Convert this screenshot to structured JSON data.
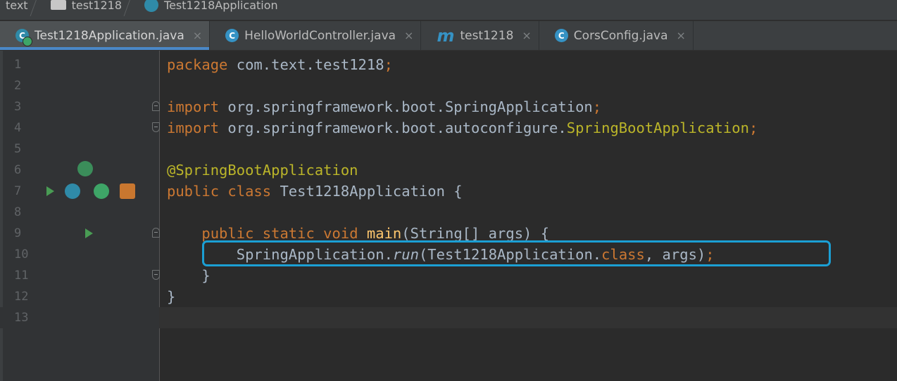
{
  "breadcrumb": [
    "text",
    "test1218",
    "Test1218Application"
  ],
  "tabs": [
    {
      "label": "Test1218Application.java",
      "icon": "spring-class-icon",
      "active": true
    },
    {
      "label": "HelloWorldController.java",
      "icon": "class-icon",
      "active": false
    },
    {
      "label": "test1218",
      "icon": "maven-icon",
      "active": false
    },
    {
      "label": "CorsConfig.java",
      "icon": "class-icon",
      "active": false
    }
  ],
  "tab_close": "×",
  "class_icon_letter": "C",
  "maven_icon_letter": "m",
  "line_numbers": [
    "1",
    "2",
    "3",
    "4",
    "5",
    "6",
    "7",
    "8",
    "9",
    "10",
    "11",
    "12",
    "13"
  ],
  "code": {
    "l1": {
      "kw": "package",
      "rest": " com.text.test1218",
      "semi": ";"
    },
    "l3": {
      "kw": "import",
      "rest": " org.springframework.boot.SpringApplication",
      "semi": ";"
    },
    "l4": {
      "kw": "import",
      "rest": " org.springframework.boot.autoconfigure.",
      "cls": "SpringBootApplication",
      "semi": ";"
    },
    "l6": {
      "annotation": "@SpringBootApplication"
    },
    "l7": {
      "kw": "public class",
      "rest": " Test1218Application {"
    },
    "l9": {
      "indent": "    ",
      "kw": "public static void",
      "sp": " ",
      "fn": "main",
      "rest": "(String[] args) {"
    },
    "l10": {
      "indent": "        ",
      "a": "SpringApplication.",
      "run": "run",
      "b": "(Test1218Application.",
      "kw": "class",
      "c": ", args)",
      "semi": ";"
    },
    "l11": {
      "text": "    }"
    },
    "l12": {
      "text": "}"
    }
  },
  "colors": {
    "keyword": "#cc7832",
    "annotation": "#bbb529",
    "method": "#ffc66d",
    "text": "#a9b7c6",
    "highlight": "#1b9fd4"
  }
}
